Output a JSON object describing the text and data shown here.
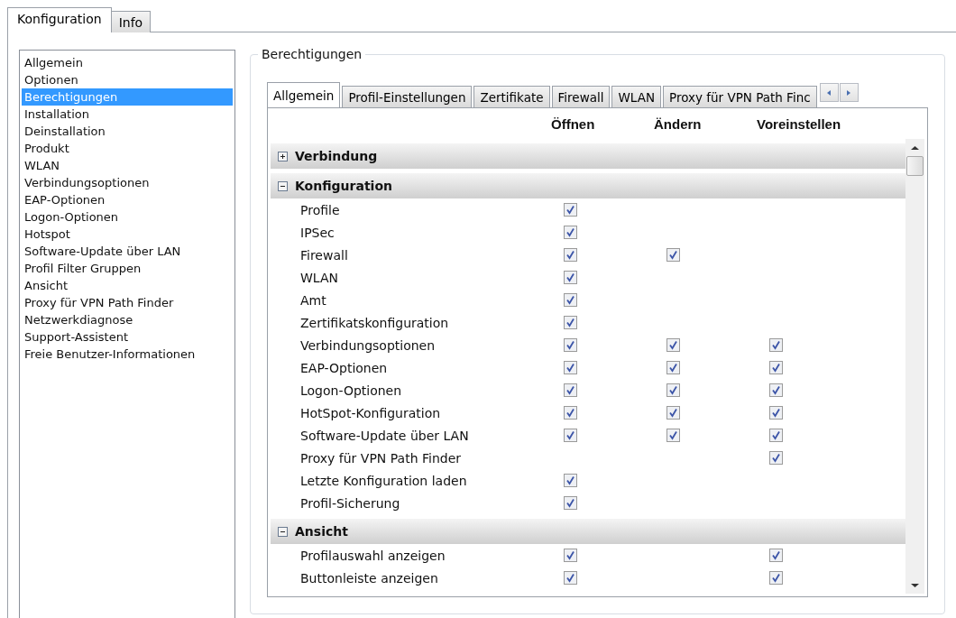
{
  "outer_tabs": [
    {
      "label": "Konfiguration",
      "selected": true
    },
    {
      "label": "Info",
      "selected": false
    }
  ],
  "sidebar": {
    "items": [
      {
        "label": "Allgemein",
        "selected": false
      },
      {
        "label": "Optionen",
        "selected": false
      },
      {
        "label": "Berechtigungen",
        "selected": true
      },
      {
        "label": "Installation",
        "selected": false
      },
      {
        "label": "Deinstallation",
        "selected": false
      },
      {
        "label": "Produkt",
        "selected": false
      },
      {
        "label": "WLAN",
        "selected": false
      },
      {
        "label": "Verbindungsoptionen",
        "selected": false
      },
      {
        "label": "EAP-Optionen",
        "selected": false
      },
      {
        "label": "Logon-Optionen",
        "selected": false
      },
      {
        "label": "Hotspot",
        "selected": false
      },
      {
        "label": "Software-Update über LAN",
        "selected": false
      },
      {
        "label": "Profil Filter Gruppen",
        "selected": false
      },
      {
        "label": "Ansicht",
        "selected": false
      },
      {
        "label": "Proxy für VPN Path Finder",
        "selected": false
      },
      {
        "label": "Netzwerkdiagnose",
        "selected": false
      },
      {
        "label": "Support-Assistent",
        "selected": false
      },
      {
        "label": "Freie Benutzer-Informationen",
        "selected": false
      }
    ]
  },
  "group": {
    "title": "Berechtigungen",
    "tabs": [
      {
        "label": "Allgemein",
        "selected": true
      },
      {
        "label": "Profil-Einstellungen",
        "selected": false
      },
      {
        "label": "Zertifikate",
        "selected": false
      },
      {
        "label": "Firewall",
        "selected": false
      },
      {
        "label": "WLAN",
        "selected": false
      },
      {
        "label": "Proxy für VPN Path Finc",
        "selected": false
      }
    ],
    "columns": [
      "Öffnen",
      "Ändern",
      "Voreinstellen"
    ],
    "sections": [
      {
        "title": "Verbindung",
        "expanded": false
      },
      {
        "title": "Konfiguration",
        "expanded": true,
        "rows": [
          {
            "label": "Profile",
            "open": true
          },
          {
            "label": "IPSec",
            "open": true
          },
          {
            "label": "Firewall",
            "open": true,
            "change": true
          },
          {
            "label": "WLAN",
            "open": true
          },
          {
            "label": "Amt",
            "open": true
          },
          {
            "label": "Zertifikatskonfiguration",
            "open": true
          },
          {
            "label": "Verbindungsoptionen",
            "open": true,
            "change": true,
            "preset": true
          },
          {
            "label": "EAP-Optionen",
            "open": true,
            "change": true,
            "preset": true
          },
          {
            "label": "Logon-Optionen",
            "open": true,
            "change": true,
            "preset": true
          },
          {
            "label": "HotSpot-Konfiguration",
            "open": true,
            "change": true,
            "preset": true
          },
          {
            "label": "Software-Update über LAN",
            "open": true,
            "change": true,
            "preset": true
          },
          {
            "label": "Proxy für VPN Path Finder",
            "preset": true
          },
          {
            "label": "Letzte Konfiguration laden",
            "open": true
          },
          {
            "label": "Profil-Sicherung",
            "open": true
          }
        ]
      },
      {
        "title": "Ansicht",
        "expanded": true,
        "rows": [
          {
            "label": "Profilauswahl anzeigen",
            "open": true,
            "preset": true
          },
          {
            "label": "Buttonleiste anzeigen",
            "open": true,
            "preset": true
          }
        ]
      }
    ]
  }
}
